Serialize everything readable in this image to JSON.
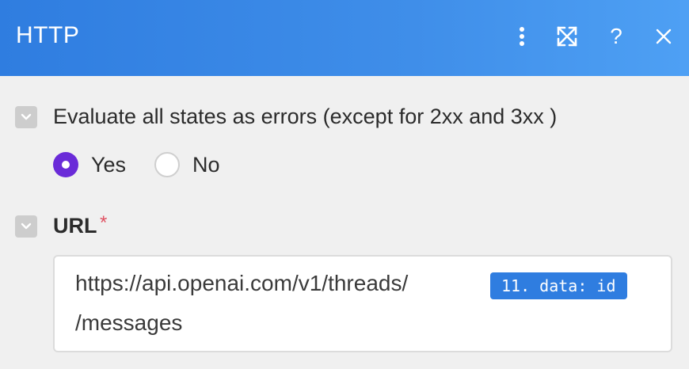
{
  "header": {
    "title": "HTTP",
    "menu_icon": "more-vertical-icon",
    "expand_icon": "expand-arrows-icon",
    "help_label": "?",
    "close_icon": "close-icon",
    "gradient_start": "#2f7de0",
    "gradient_end": "#4ea0f4"
  },
  "evaluate_errors": {
    "label": "Evaluate all states as errors (except for 2xx and 3xx )",
    "options": [
      {
        "label": "Yes",
        "selected": true
      },
      {
        "label": "No",
        "selected": false
      }
    ],
    "accent_color": "#6a2bd8"
  },
  "url": {
    "label": "URL",
    "required_mark": "*",
    "value_prefix": "https://api.openai.com/v1/threads/",
    "pill_text": "11. data: id",
    "value_suffix": "/messages",
    "pill_color": "#2f7de0"
  }
}
